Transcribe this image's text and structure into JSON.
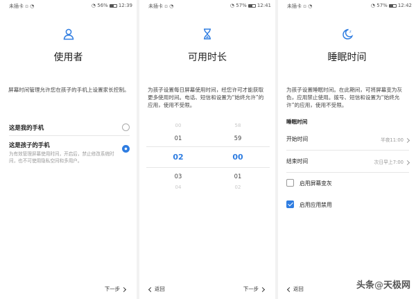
{
  "screens": [
    {
      "status": {
        "carrier": "未插卡",
        "battery": "56%",
        "time": "12:39"
      },
      "title": "使用者",
      "description": "屏幕时间管理允许您在孩子的手机上设置家长控制。",
      "options": [
        {
          "label": "这是我的手机",
          "selected": false
        },
        {
          "label": "这是孩子的手机",
          "sub": "为有效管理屏幕使用时间，开启后，禁止修改系统时间，也不可使用隐私空间和多用户。",
          "selected": true
        }
      ],
      "footer": {
        "next": "下一步"
      }
    },
    {
      "status": {
        "carrier": "未插卡",
        "battery": "57%",
        "time": "12:41"
      },
      "title": "可用时长",
      "description": "为孩子设置每日屏幕使用时间，经您许可才能获取更多使用时间。电话、短信和设置为“始终允许”的应用，使用不受限。",
      "picker": {
        "hours": [
          "00",
          "01",
          "02",
          "03",
          "04"
        ],
        "minutes": [
          "58",
          "59",
          "00",
          "01",
          "02"
        ],
        "selected_hour": "02",
        "selected_minute": "00"
      },
      "footer": {
        "back": "返回",
        "next": "下一步"
      }
    },
    {
      "status": {
        "carrier": "未插卡",
        "battery": "57%",
        "time": "12:42"
      },
      "title": "睡眠时间",
      "description": "为孩子设置睡眠时间。在此期间，可将屏幕变为灰色，应用禁止使用。拨号、短信和设置为“始终允许”的应用，使用不受限。",
      "section_header": "睡眠时间",
      "rows": [
        {
          "label": "开始时间",
          "value": "半夜11:00"
        },
        {
          "label": "结束时间",
          "value": "次日早上7:00"
        }
      ],
      "checkboxes": [
        {
          "label": "启用屏幕变灰",
          "checked": false
        },
        {
          "label": "启用应用禁用",
          "checked": true
        }
      ],
      "footer": {
        "back": "返回"
      }
    }
  ],
  "watermark": {
    "prefix": "头条",
    "at": "@",
    "name": "天极网"
  },
  "colors": {
    "accent": "#2f7de1"
  }
}
